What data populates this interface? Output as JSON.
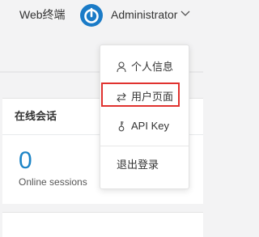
{
  "header": {
    "web_terminal": "Web终端",
    "user_name": "Administrator"
  },
  "card": {
    "title": "在线会话",
    "count": "0",
    "subtitle": "Online sessions"
  },
  "user_dropdown": {
    "items": [
      {
        "label": "个人信息",
        "icon": "user-icon"
      },
      {
        "label": "用户页面",
        "icon": "exchange-icon",
        "highlighted": true
      },
      {
        "label": "API Key",
        "icon": "key-icon"
      },
      {
        "label": "退出登录",
        "icon": null
      }
    ]
  },
  "colors": {
    "accent": "#1c84c6",
    "avatar": "#1a7bc7",
    "highlight": "#e0322f"
  }
}
